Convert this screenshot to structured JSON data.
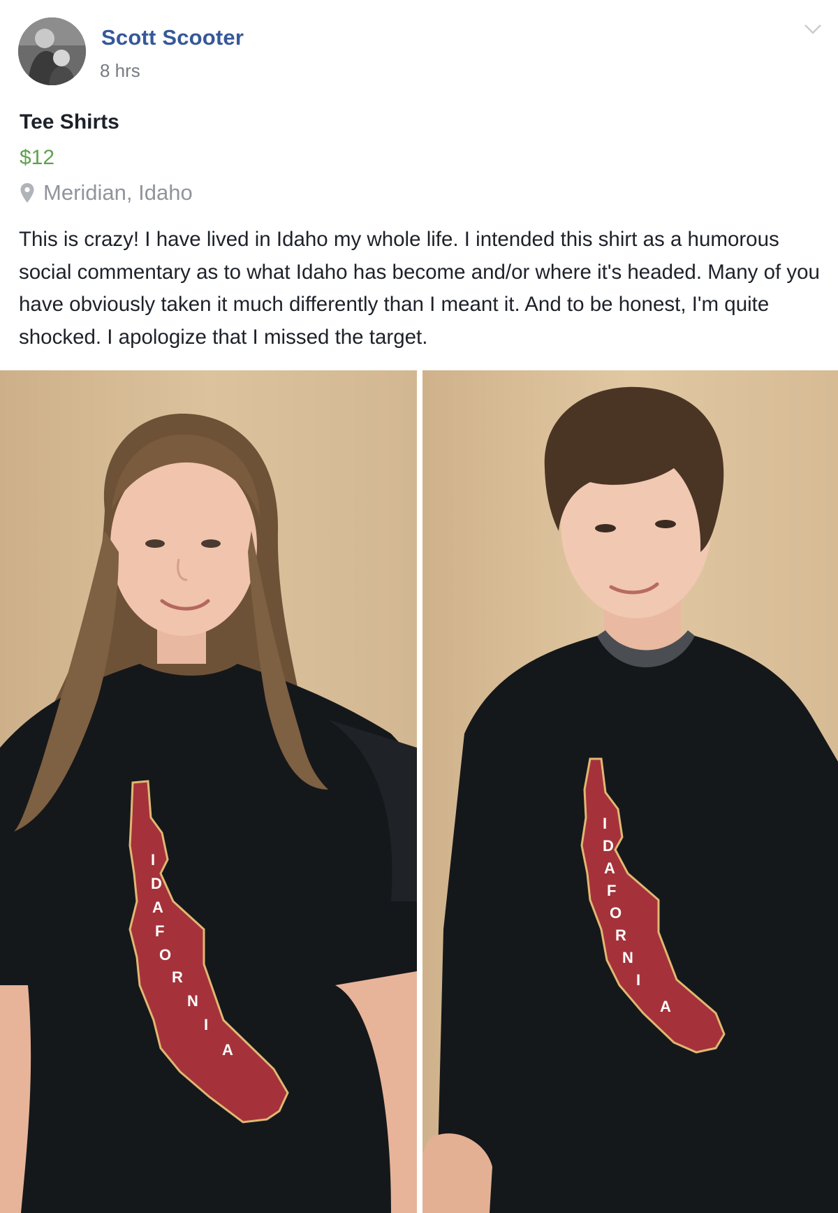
{
  "post": {
    "author": "Scott Scooter",
    "timestamp": "8 hrs",
    "item_title": "Tee Shirts",
    "price": "$12",
    "location": "Meridian, Idaho",
    "body": "This is crazy! I have lived in Idaho my whole life. I intended this shirt as a humorous social commentary as to what Idaho has become and/or where it's headed. Many of you have obviously taken it much differently than I meant it. And to be honest, I'm quite shocked. I apologize that I missed the target."
  },
  "icons": {
    "chevron": "chevron-down-icon",
    "location": "map-pin-icon"
  },
  "photos": [
    {
      "shirt_letters": [
        "I",
        "D",
        "A",
        "F",
        "O",
        "R",
        "N",
        "I",
        "A"
      ]
    },
    {
      "shirt_letters": [
        "I",
        "D",
        "A",
        "F",
        "O",
        "R",
        "N",
        "I",
        "A"
      ]
    }
  ],
  "colors": {
    "author_link": "#365899",
    "price": "#5fa24e",
    "muted": "#90949c",
    "wall": "#d9bf96",
    "shirt": "#15181b",
    "shirt_print": "#a5323a"
  }
}
